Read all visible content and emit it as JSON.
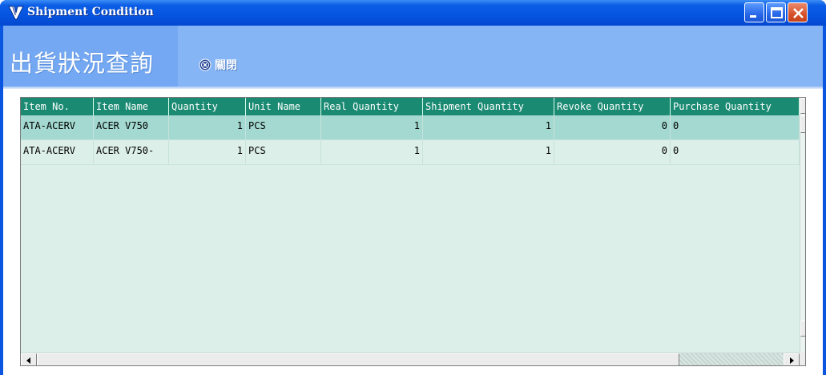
{
  "window": {
    "title": "Shipment Condition",
    "icon": "app-v-icon"
  },
  "toolbar": {
    "form_title": "出貨狀況查詢",
    "close_label": "關閉",
    "close_icon": "close-circle-icon"
  },
  "grid": {
    "columns": [
      "Item No.",
      "Item Name",
      "Quantity",
      "Unit Name",
      "Real Quantity",
      "Shipment Quantity",
      "Revoke Quantity",
      "Purchase Quantity"
    ],
    "rows": [
      [
        "ATA-ACERV",
        "ACER V750",
        "1",
        "PCS",
        "1",
        "1",
        "0",
        "0"
      ],
      [
        "ATA-ACERV",
        "ACER V750-",
        "1",
        "PCS",
        "1",
        "1",
        "0",
        "0"
      ]
    ]
  },
  "colors": {
    "titlebar": "#0554e1",
    "toolbar": "#86b5f5",
    "header_bg": "#1a8a72",
    "selected_row": "#a3d9d0",
    "grid_bg": "#dcefe9"
  }
}
